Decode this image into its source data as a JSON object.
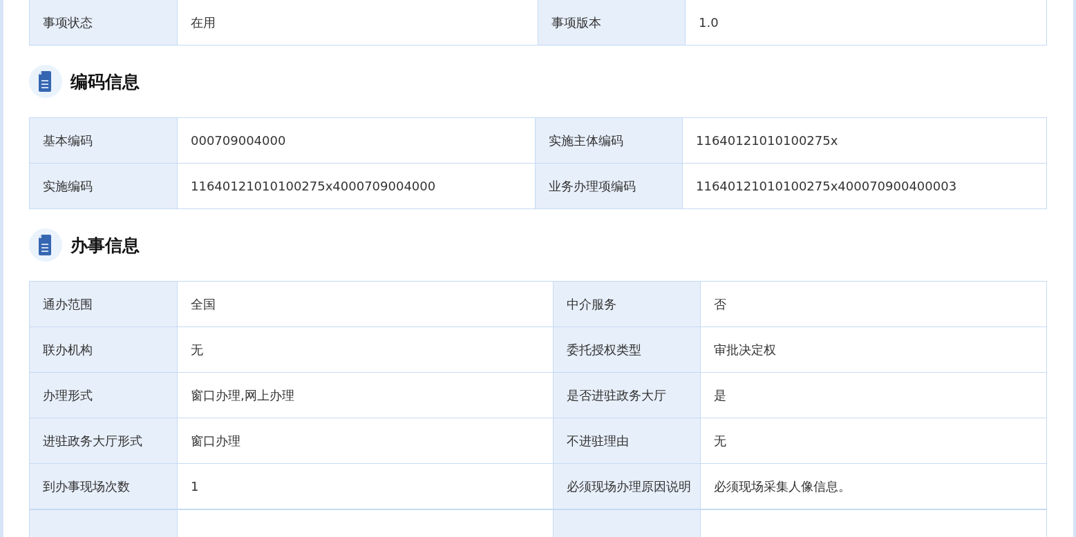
{
  "sections": [
    {
      "rows": [
        [
          {
            "label": "事项状态",
            "value": "在用"
          },
          {
            "label": "事项版本",
            "value": "1.0"
          }
        ]
      ]
    },
    {
      "title": "编码信息",
      "rows": [
        [
          {
            "label": "基本编码",
            "value": "000709004000"
          },
          {
            "label": "实施主体编码",
            "value": "11640121010100275x"
          }
        ],
        [
          {
            "label": "实施编码",
            "value": "11640121010100275x4000709004000"
          },
          {
            "label": "业务办理项编码",
            "value": "11640121010100275x400070900400003"
          }
        ]
      ]
    },
    {
      "title": "办事信息",
      "rows": [
        [
          {
            "label": "通办范围",
            "value": "全国"
          },
          {
            "label": "中介服务",
            "value": "否"
          }
        ],
        [
          {
            "label": "联办机构",
            "value": "无"
          },
          {
            "label": "委托授权类型",
            "value": "审批决定权"
          }
        ],
        [
          {
            "label": "办理形式",
            "value": "窗口办理,网上办理"
          },
          {
            "label": "是否进驻政务大厅",
            "value": "是"
          }
        ],
        [
          {
            "label": "进驻政务大厅形式",
            "value": "窗口办理"
          },
          {
            "label": "不进驻理由",
            "value": "无"
          }
        ],
        [
          {
            "label": "到办事现场次数",
            "value": "1"
          },
          {
            "label": "必须现场办理原因说明",
            "value": "必须现场采集人像信息。"
          }
        ]
      ]
    }
  ]
}
